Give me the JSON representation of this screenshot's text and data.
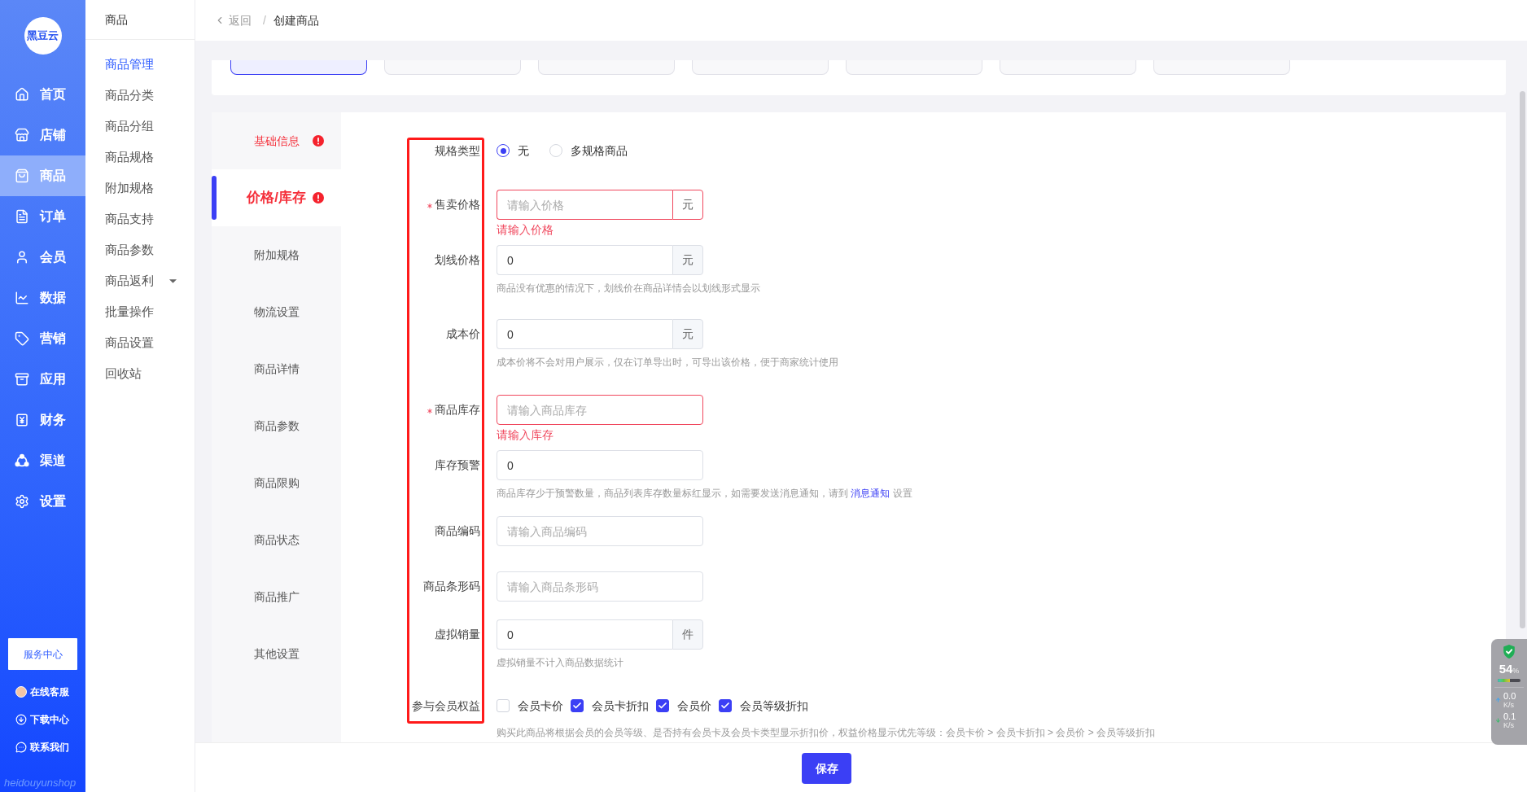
{
  "sidebar": {
    "logo": "黑豆云",
    "nav": [
      {
        "label": "首页",
        "selected": false
      },
      {
        "label": "店铺",
        "selected": false
      },
      {
        "label": "商品",
        "selected": true
      },
      {
        "label": "订单",
        "selected": false
      },
      {
        "label": "会员",
        "selected": false
      },
      {
        "label": "数据",
        "selected": false
      },
      {
        "label": "营销",
        "selected": false
      },
      {
        "label": "应用",
        "selected": false
      },
      {
        "label": "财务",
        "selected": false
      },
      {
        "label": "渠道",
        "selected": false
      },
      {
        "label": "设置",
        "selected": false
      }
    ],
    "service_button": "服务中心",
    "links": [
      {
        "label": "在线客服"
      },
      {
        "label": "下载中心"
      },
      {
        "label": "联系我们"
      }
    ],
    "brand": "heidouyunshop"
  },
  "submenu": {
    "title": "商品",
    "items": [
      {
        "label": "商品管理",
        "kind": "link",
        "selected": true
      },
      {
        "label": "商品分类",
        "kind": "link",
        "selected": false
      },
      {
        "label": "商品分组",
        "kind": "link",
        "selected": false
      },
      {
        "label": "商品规格",
        "kind": "link",
        "selected": false
      },
      {
        "label": "附加规格",
        "kind": "link",
        "selected": false
      },
      {
        "label": "商品支持",
        "kind": "link",
        "selected": false
      },
      {
        "label": "商品参数",
        "kind": "link",
        "selected": false
      },
      {
        "label": "商品返利",
        "kind": "group",
        "selected": false
      },
      {
        "label": "批量操作",
        "kind": "link",
        "selected": false
      },
      {
        "label": "商品设置",
        "kind": "link",
        "selected": false
      },
      {
        "label": "回收站",
        "kind": "link",
        "selected": false
      }
    ]
  },
  "breadcrumb": {
    "back": "返回",
    "separator": "/",
    "current": "创建商品"
  },
  "delivery_options": [
    {
      "selected": true
    },
    {
      "selected": false
    },
    {
      "selected": false
    },
    {
      "selected": false
    },
    {
      "selected": false
    },
    {
      "selected": false
    },
    {
      "selected": false
    }
  ],
  "section_tabs": [
    {
      "label": "基础信息",
      "selected": false,
      "error": true
    },
    {
      "label": "价格/库存",
      "selected": true,
      "error": true
    },
    {
      "label": "附加规格",
      "selected": false,
      "error": false
    },
    {
      "label": "物流设置",
      "selected": false,
      "error": false
    },
    {
      "label": "商品详情",
      "selected": false,
      "error": false
    },
    {
      "label": "商品参数",
      "selected": false,
      "error": false
    },
    {
      "label": "商品限购",
      "selected": false,
      "error": false
    },
    {
      "label": "商品状态",
      "selected": false,
      "error": false
    },
    {
      "label": "商品推广",
      "selected": false,
      "error": false
    },
    {
      "label": "其他设置",
      "selected": false,
      "error": false
    }
  ],
  "form": {
    "fields": [
      {
        "kind": "radio",
        "label": "规格类型",
        "required": false,
        "options": [
          {
            "label": "无",
            "selected": true
          },
          {
            "label": "多规格商品",
            "selected": false
          }
        ]
      },
      {
        "kind": "input",
        "label": "售卖价格",
        "required": true,
        "placeholder": "请输入价格",
        "suffix": "元",
        "error": "请输入价格"
      },
      {
        "kind": "input",
        "label": "划线价格",
        "required": false,
        "value": "0",
        "suffix": "元",
        "hint": "商品没有优惠的情况下，划线价在商品详情会以划线形式显示"
      },
      {
        "kind": "input",
        "label": "成本价",
        "required": false,
        "value": "0",
        "suffix": "元",
        "hint": "成本价将不会对用户展示，仅在订单导出时，可导出该价格，便于商家统计使用"
      },
      {
        "kind": "input",
        "label": "商品库存",
        "required": true,
        "placeholder": "请输入商品库存",
        "error": "请输入库存"
      },
      {
        "kind": "input",
        "label": "库存预警",
        "required": false,
        "value": "0",
        "hint": "商品库存少于预警数量，商品列表库存数量标红显示，如需要发送消息通知，请到",
        "hint_link": "消息通知",
        "hint_end": "设置"
      },
      {
        "kind": "input",
        "label": "商品编码",
        "required": false,
        "placeholder": "请输入商品编码"
      },
      {
        "kind": "input",
        "label": "商品条形码",
        "required": false,
        "placeholder": "请输入商品条形码"
      },
      {
        "kind": "input",
        "label": "虚拟销量",
        "required": false,
        "value": "0",
        "suffix": "件",
        "hint": "虚拟销量不计入商品数据统计"
      },
      {
        "kind": "checkbox",
        "label": "参与会员权益",
        "required": false,
        "options": [
          {
            "label": "会员卡价",
            "checked": false
          },
          {
            "label": "会员卡折扣",
            "checked": true
          },
          {
            "label": "会员价",
            "checked": true
          },
          {
            "label": "会员等级折扣",
            "checked": true
          }
        ],
        "hint": "购买此商品将根据会员的会员等级、是否持有会员卡及会员卡类型显示折扣价，权益价格显示优先等级：会员卡价 > 会员卡折扣 > 会员价 > 会员等级折扣"
      }
    ]
  },
  "footer": {
    "save_button": "保存"
  },
  "network_monitor": {
    "usage": "54",
    "usage_unit": "%",
    "level": 0.54,
    "upload": "0.0",
    "upload_unit": "K/s",
    "download": "0.1",
    "download_unit": "K/s"
  }
}
